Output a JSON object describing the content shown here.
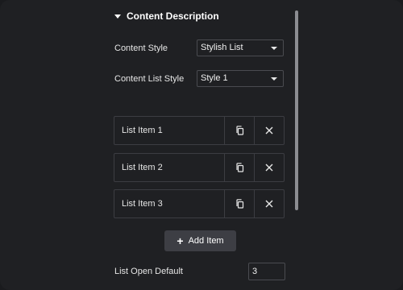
{
  "section": {
    "title": "Content Description"
  },
  "content_style": {
    "label": "Content Style",
    "value": "Stylish List"
  },
  "content_list_style": {
    "label": "Content List Style",
    "value": "Style 1"
  },
  "items": [
    {
      "label": "List Item 1"
    },
    {
      "label": "List Item 2"
    },
    {
      "label": "List Item 3"
    }
  ],
  "add_item": {
    "label": "Add Item"
  },
  "list_open_default": {
    "label": "List Open Default",
    "value": "3"
  }
}
